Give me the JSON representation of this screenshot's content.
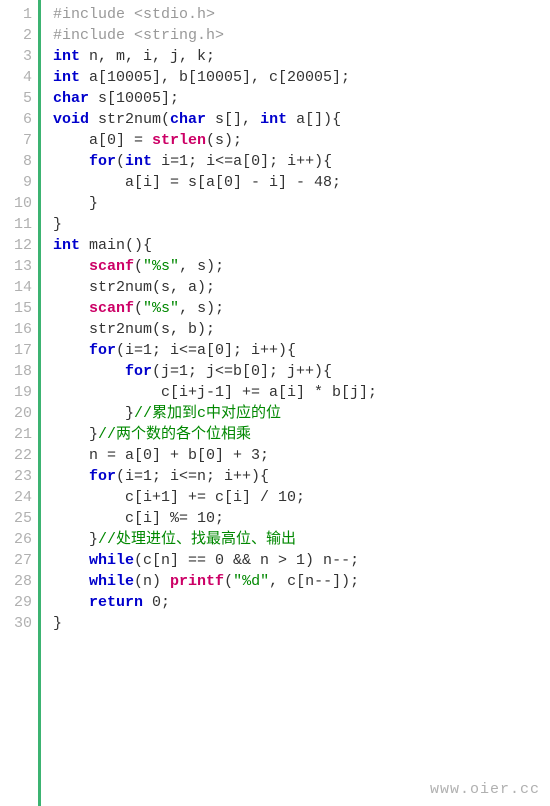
{
  "watermark": "www.oier.cc",
  "lines": [
    {
      "n": "1",
      "segs": [
        {
          "c": "pp",
          "t": "#include <stdio.h>"
        }
      ]
    },
    {
      "n": "2",
      "segs": [
        {
          "c": "pp",
          "t": "#include <string.h>"
        }
      ]
    },
    {
      "n": "3",
      "segs": [
        {
          "c": "kw",
          "t": "int"
        },
        {
          "c": "p",
          "t": " n, m, i, j, k;"
        }
      ]
    },
    {
      "n": "4",
      "segs": [
        {
          "c": "kw",
          "t": "int"
        },
        {
          "c": "p",
          "t": " a[10005], b[10005], c[20005];"
        }
      ]
    },
    {
      "n": "5",
      "segs": [
        {
          "c": "kw",
          "t": "char"
        },
        {
          "c": "p",
          "t": " s[10005];"
        }
      ]
    },
    {
      "n": "6",
      "segs": [
        {
          "c": "kw",
          "t": "void"
        },
        {
          "c": "p",
          "t": " str2num("
        },
        {
          "c": "kw",
          "t": "char"
        },
        {
          "c": "p",
          "t": " s[], "
        },
        {
          "c": "kw",
          "t": "int"
        },
        {
          "c": "p",
          "t": " a[]){"
        }
      ]
    },
    {
      "n": "7",
      "segs": [
        {
          "c": "p",
          "t": "    a[0] = "
        },
        {
          "c": "lib",
          "t": "strlen"
        },
        {
          "c": "p",
          "t": "(s);"
        }
      ]
    },
    {
      "n": "8",
      "segs": [
        {
          "c": "p",
          "t": "    "
        },
        {
          "c": "kw",
          "t": "for"
        },
        {
          "c": "p",
          "t": "("
        },
        {
          "c": "kw",
          "t": "int"
        },
        {
          "c": "p",
          "t": " i=1; i<=a[0]; i++){"
        }
      ]
    },
    {
      "n": "9",
      "segs": [
        {
          "c": "p",
          "t": "        a[i] = s[a[0] - i] - 48;"
        }
      ]
    },
    {
      "n": "10",
      "segs": [
        {
          "c": "p",
          "t": "    }"
        }
      ]
    },
    {
      "n": "11",
      "segs": [
        {
          "c": "p",
          "t": "}"
        }
      ]
    },
    {
      "n": "12",
      "segs": [
        {
          "c": "kw",
          "t": "int"
        },
        {
          "c": "p",
          "t": " main(){"
        }
      ]
    },
    {
      "n": "13",
      "segs": [
        {
          "c": "p",
          "t": "    "
        },
        {
          "c": "lib",
          "t": "scanf"
        },
        {
          "c": "p",
          "t": "("
        },
        {
          "c": "str",
          "t": "\"%s\""
        },
        {
          "c": "p",
          "t": ", s);"
        }
      ]
    },
    {
      "n": "14",
      "segs": [
        {
          "c": "p",
          "t": "    str2num(s, a);"
        }
      ]
    },
    {
      "n": "15",
      "segs": [
        {
          "c": "p",
          "t": "    "
        },
        {
          "c": "lib",
          "t": "scanf"
        },
        {
          "c": "p",
          "t": "("
        },
        {
          "c": "str",
          "t": "\"%s\""
        },
        {
          "c": "p",
          "t": ", s);"
        }
      ]
    },
    {
      "n": "16",
      "segs": [
        {
          "c": "p",
          "t": "    str2num(s, b);"
        }
      ]
    },
    {
      "n": "17",
      "segs": [
        {
          "c": "p",
          "t": "    "
        },
        {
          "c": "kw",
          "t": "for"
        },
        {
          "c": "p",
          "t": "(i=1; i<=a[0]; i++){"
        }
      ]
    },
    {
      "n": "18",
      "segs": [
        {
          "c": "p",
          "t": "        "
        },
        {
          "c": "kw",
          "t": "for"
        },
        {
          "c": "p",
          "t": "(j=1; j<=b[0]; j++){"
        }
      ]
    },
    {
      "n": "19",
      "segs": [
        {
          "c": "p",
          "t": "            c[i+j-1] += a[i] * b[j];"
        }
      ]
    },
    {
      "n": "20",
      "segs": [
        {
          "c": "p",
          "t": "        }"
        },
        {
          "c": "cmt",
          "t": "//累加到c中对应的位"
        }
      ]
    },
    {
      "n": "21",
      "segs": [
        {
          "c": "p",
          "t": "    }"
        },
        {
          "c": "cmt",
          "t": "//两个数的各个位相乘"
        }
      ]
    },
    {
      "n": "22",
      "segs": [
        {
          "c": "p",
          "t": "    n = a[0] + b[0] + 3;"
        }
      ]
    },
    {
      "n": "23",
      "segs": [
        {
          "c": "p",
          "t": "    "
        },
        {
          "c": "kw",
          "t": "for"
        },
        {
          "c": "p",
          "t": "(i=1; i<=n; i++){"
        }
      ]
    },
    {
      "n": "24",
      "segs": [
        {
          "c": "p",
          "t": "        c[i+1] += c[i] / 10;"
        }
      ]
    },
    {
      "n": "25",
      "segs": [
        {
          "c": "p",
          "t": "        c[i] %= 10;"
        }
      ]
    },
    {
      "n": "26",
      "segs": [
        {
          "c": "p",
          "t": "    }"
        },
        {
          "c": "cmt",
          "t": "//处理进位、找最高位、输出"
        }
      ]
    },
    {
      "n": "27",
      "segs": [
        {
          "c": "p",
          "t": "    "
        },
        {
          "c": "kw",
          "t": "while"
        },
        {
          "c": "p",
          "t": "(c[n] == 0 && n > 1) n--;"
        }
      ]
    },
    {
      "n": "28",
      "segs": [
        {
          "c": "p",
          "t": "    "
        },
        {
          "c": "kw",
          "t": "while"
        },
        {
          "c": "p",
          "t": "(n) "
        },
        {
          "c": "lib",
          "t": "printf"
        },
        {
          "c": "p",
          "t": "("
        },
        {
          "c": "str",
          "t": "\"%d\""
        },
        {
          "c": "p",
          "t": ", c[n--]);"
        }
      ]
    },
    {
      "n": "29",
      "segs": [
        {
          "c": "p",
          "t": "    "
        },
        {
          "c": "kw",
          "t": "return"
        },
        {
          "c": "p",
          "t": " 0;"
        }
      ]
    },
    {
      "n": "30",
      "segs": [
        {
          "c": "p",
          "t": "}"
        }
      ]
    }
  ]
}
